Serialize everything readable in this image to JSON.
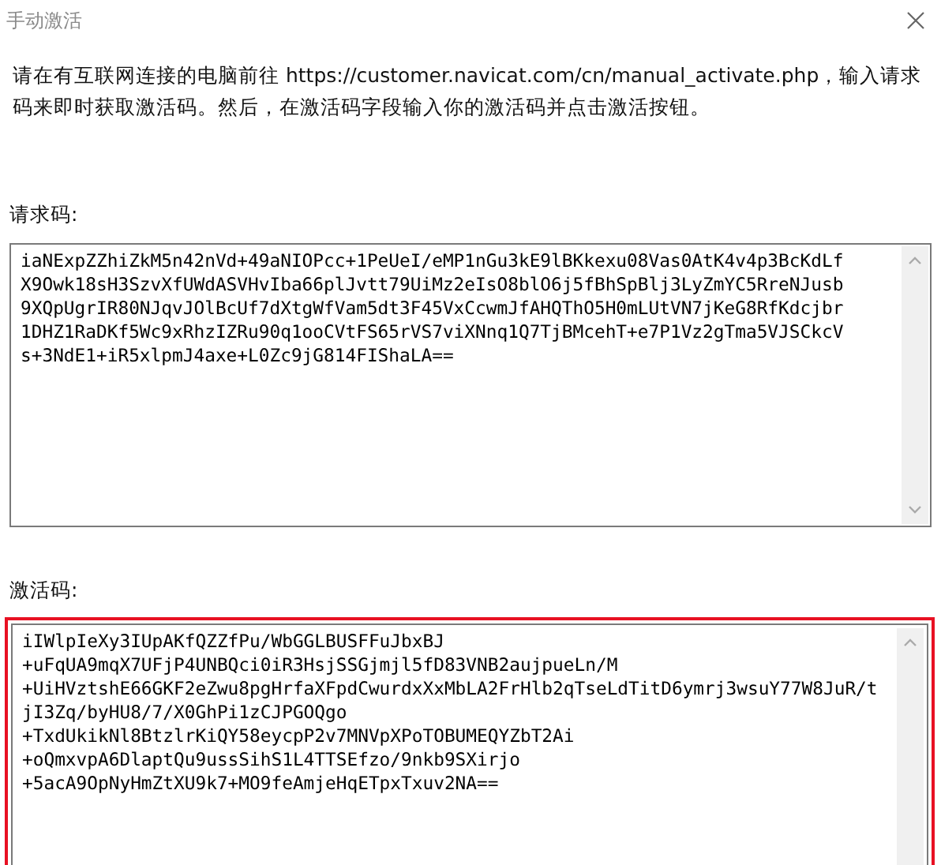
{
  "window": {
    "title": "手动激活"
  },
  "instructions": "请在有互联网连接的电脑前往 https://customer.navicat.com/cn/manual_activate.php，输入请求码来即时获取激活码。然后，在激活码字段输入你的激活码并点击激活按钮。",
  "fields": [
    {
      "label": "请求码:",
      "highlighted": false,
      "lines": [
        "iaNExpZZhiZkM5n42nVd+49aNIOPcc+1PeUeI/eMP1nGu3kE9lBKkexu08Vas0AtK4v4p3BcKdLf",
        "X9Owk18sH3SzvXfUWdASVHvIba66plJvtt79UiMz2eIsO8blO6j5fBhSpBlj3LyZmYC5RreNJusb",
        "9XQpUgrIR80NJqvJOlBcUf7dXtgWfVam5dt3F45VxCcwmJfAHQThO5H0mLUtVN7jKeG8RfKdcjbr",
        "1DHZ1RaDKf5Wc9xRhzIZRu90q1ooCVtFS65rVS7viXNnq1Q7TjBMcehT+e7P1Vz2gTma5VJSCkcV",
        "s+3NdE1+iR5xlpmJ4axe+L0Zc9jG814FIShaLA=="
      ]
    },
    {
      "label": "激活码:",
      "highlighted": true,
      "lines": [
        "iIWlpIeXy3IUpAKfQZZfPu/WbGGLBUSFFuJbxBJ",
        "+uFqUA9mqX7UFjP4UNBQci0iR3HsjSSGjmjl5fD83VNB2aujpueLn/M",
        "+UiHVztshE66GKF2eZwu8pgHrfaXFpdCwurdxXxMbLA2FrHlb2qTseLdTitD6ymrj3wsuY77W8JuR/t",
        "jI3Zq/byHU8/7/X0GhPi1zCJPGOQgo",
        "+TxdUkikNl8BtzlrKiQY58eycpP2v7MNVpXPoTOBUMEQYZbT2Ai",
        "+oQmxvpA6DlaptQu9ussSihS1L4TTSEfzo/9nkb9SXirjo",
        "+5acA9OpNyHmZtXU9k7+MO9feAmjeHqETpxTxuv2NA=="
      ]
    }
  ]
}
